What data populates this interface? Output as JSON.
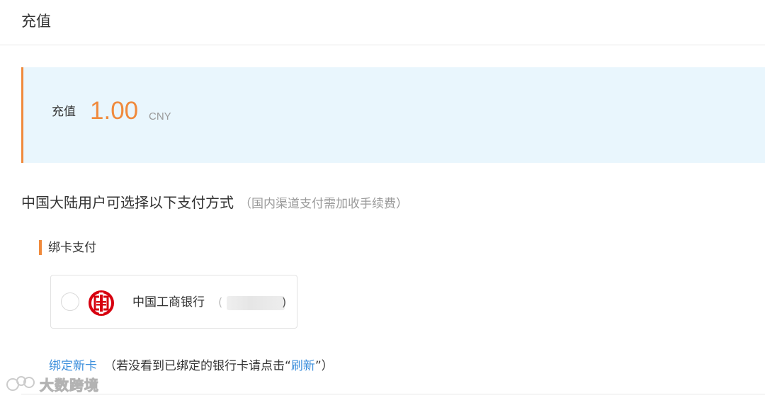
{
  "header": {
    "title": "充值"
  },
  "recharge": {
    "label": "充值",
    "amount": "1.00",
    "currency": "CNY"
  },
  "payment_section": {
    "title": "中国大陆用户可选择以下支付方式",
    "note": "（国内渠道支付需加收手续费）"
  },
  "card_payment": {
    "title": "绑卡支付",
    "bank": {
      "name": "中国工商银行",
      "masked_open": "(",
      "masked_close": ")"
    }
  },
  "bind": {
    "new_card_label": "绑定新卡",
    "note_prefix": "（若没看到已绑定的银行卡请点击“",
    "refresh_label": "刷新",
    "note_suffix": "”）"
  },
  "watermark": {
    "text": "大数跨境"
  },
  "colors": {
    "accent": "#f08a3c",
    "link": "#3d8fdc",
    "panel_bg": "#e9f6fd",
    "bank_red": "#d7000f"
  }
}
